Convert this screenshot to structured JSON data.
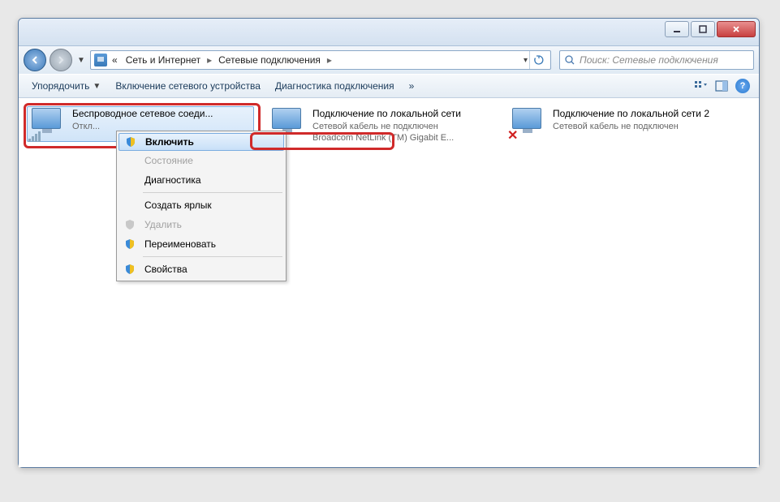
{
  "breadcrumb": {
    "prefix": "«",
    "level1": "Сеть и Интернет",
    "level2": "Сетевые подключения"
  },
  "search": {
    "placeholder": "Поиск: Сетевые подключения"
  },
  "toolbar": {
    "organize": "Упорядочить",
    "enable_device": "Включение сетевого устройства",
    "diagnose": "Диагностика подключения",
    "overflow": "»"
  },
  "connections": [
    {
      "title": "Беспроводное сетевое соеди...",
      "sub1": "Откл...",
      "sub2": "",
      "type": "wifi",
      "selected": true
    },
    {
      "title": "Подключение по локальной сети",
      "sub1": "Сетевой кабель не подключен",
      "sub2": "Broadcom NetLink (TM) Gigabit E...",
      "type": "lan",
      "selected": false
    },
    {
      "title": "Подключение по локальной сети 2",
      "sub1": "Сетевой кабель не подключен",
      "sub2": "",
      "type": "lan",
      "selected": false
    }
  ],
  "context_menu": {
    "enable": "Включить",
    "status": "Состояние",
    "diagnostics": "Диагностика",
    "shortcut": "Создать ярлык",
    "delete": "Удалить",
    "rename": "Переименовать",
    "properties": "Свойства"
  }
}
